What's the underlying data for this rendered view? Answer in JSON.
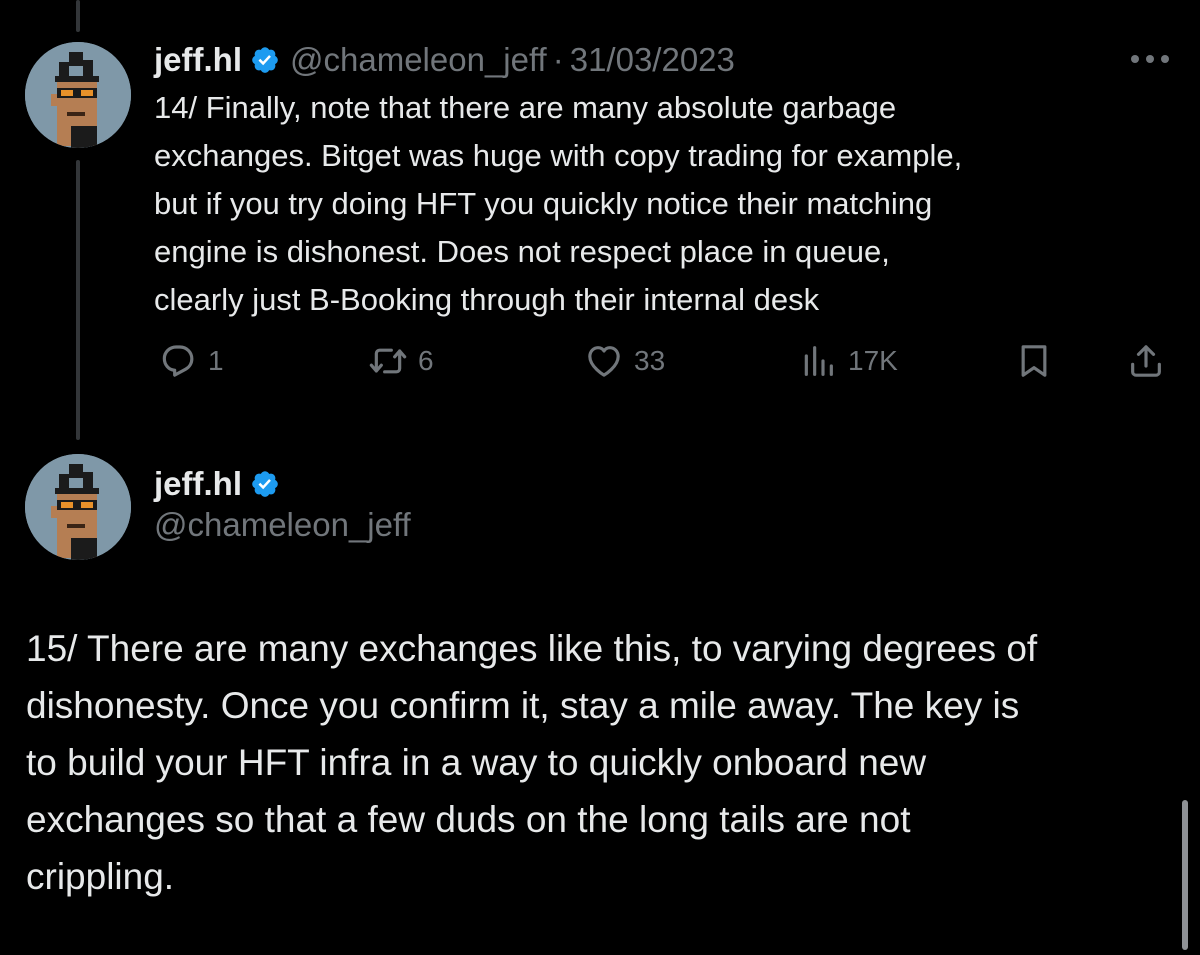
{
  "tweet1": {
    "display_name": "jeff.hl",
    "handle": "@chameleon_jeff",
    "separator": "·",
    "date": "31/03/2023",
    "text": "14/ Finally, note that there are many absolute garbage\nexchanges. Bitget was huge with copy trading for example,\nbut if you try doing HFT you quickly notice their matching\nengine is dishonest. Does not respect place in queue,\nclearly just B-Booking through their internal desk",
    "actions": {
      "replies": "1",
      "reposts": "6",
      "likes": "33",
      "views": "17K"
    }
  },
  "tweet2": {
    "display_name": "jeff.hl",
    "handle": "@chameleon_jeff",
    "text": "15/ There are many exchanges like this, to varying degrees of\ndishonesty. Once you confirm it, stay a mile away. The key is\nto build your HFT infra in a way to quickly onboard new\nexchanges so that a few duds on the long tails are not\ncrippling."
  },
  "icons": {
    "more": "more-horizontal-icon",
    "reply": "reply-icon",
    "repost": "repost-icon",
    "like": "heart-icon",
    "views": "views-icon",
    "bookmark": "bookmark-icon",
    "share": "share-icon",
    "verified": "verified-badge-icon"
  },
  "colors": {
    "background": "#000000",
    "text": "#e7e9ea",
    "secondary": "#71767b",
    "verified": "#1d9bf0",
    "thread_line": "#333639"
  }
}
